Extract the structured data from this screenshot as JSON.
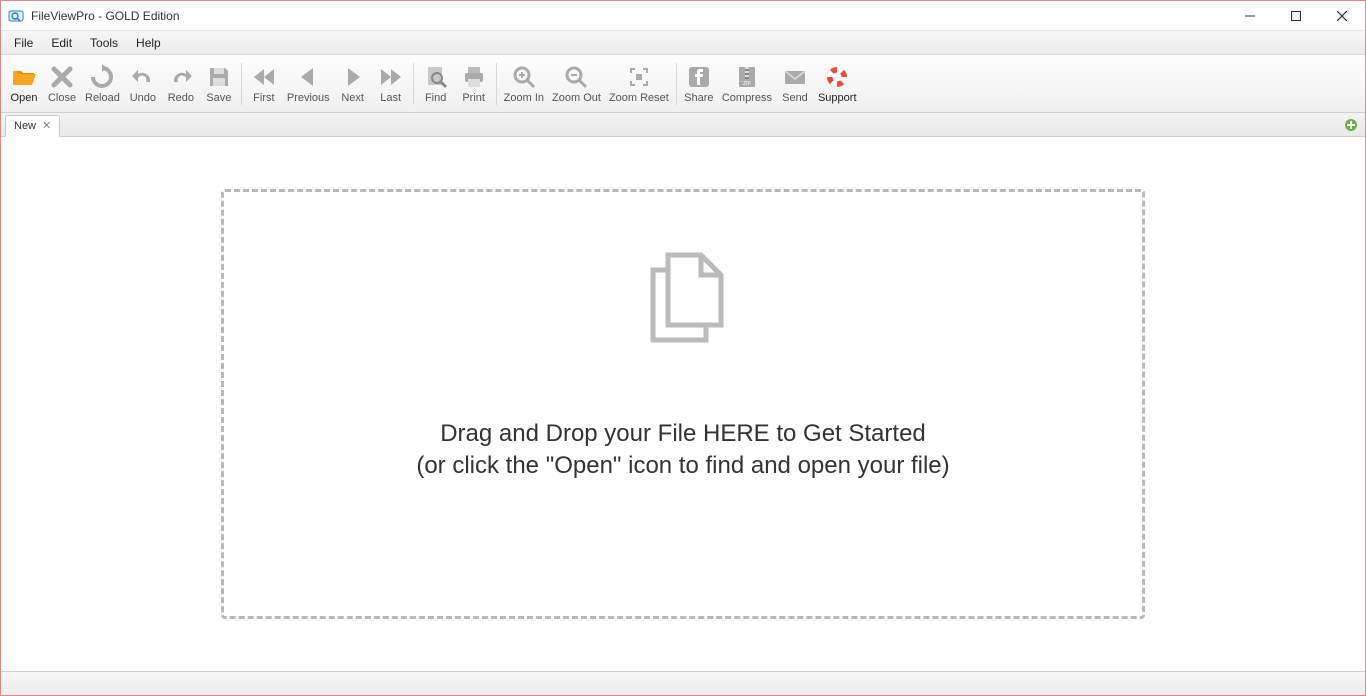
{
  "window": {
    "title": "FileViewPro - GOLD Edition"
  },
  "menu": {
    "items": [
      "File",
      "Edit",
      "Tools",
      "Help"
    ]
  },
  "toolbar": {
    "open": "Open",
    "close": "Close",
    "reload": "Reload",
    "undo": "Undo",
    "redo": "Redo",
    "save": "Save",
    "first": "First",
    "previous": "Previous",
    "next": "Next",
    "last": "Last",
    "find": "Find",
    "print": "Print",
    "zoom_in": "Zoom In",
    "zoom_out": "Zoom Out",
    "zoom_reset": "Zoom Reset",
    "share": "Share",
    "compress": "Compress",
    "send": "Send",
    "support": "Support"
  },
  "tabs": {
    "active": "New"
  },
  "dropzone": {
    "line1": "Drag and Drop your File HERE to Get Started",
    "line2": "(or click the \"Open\" icon to find and open your file)"
  }
}
